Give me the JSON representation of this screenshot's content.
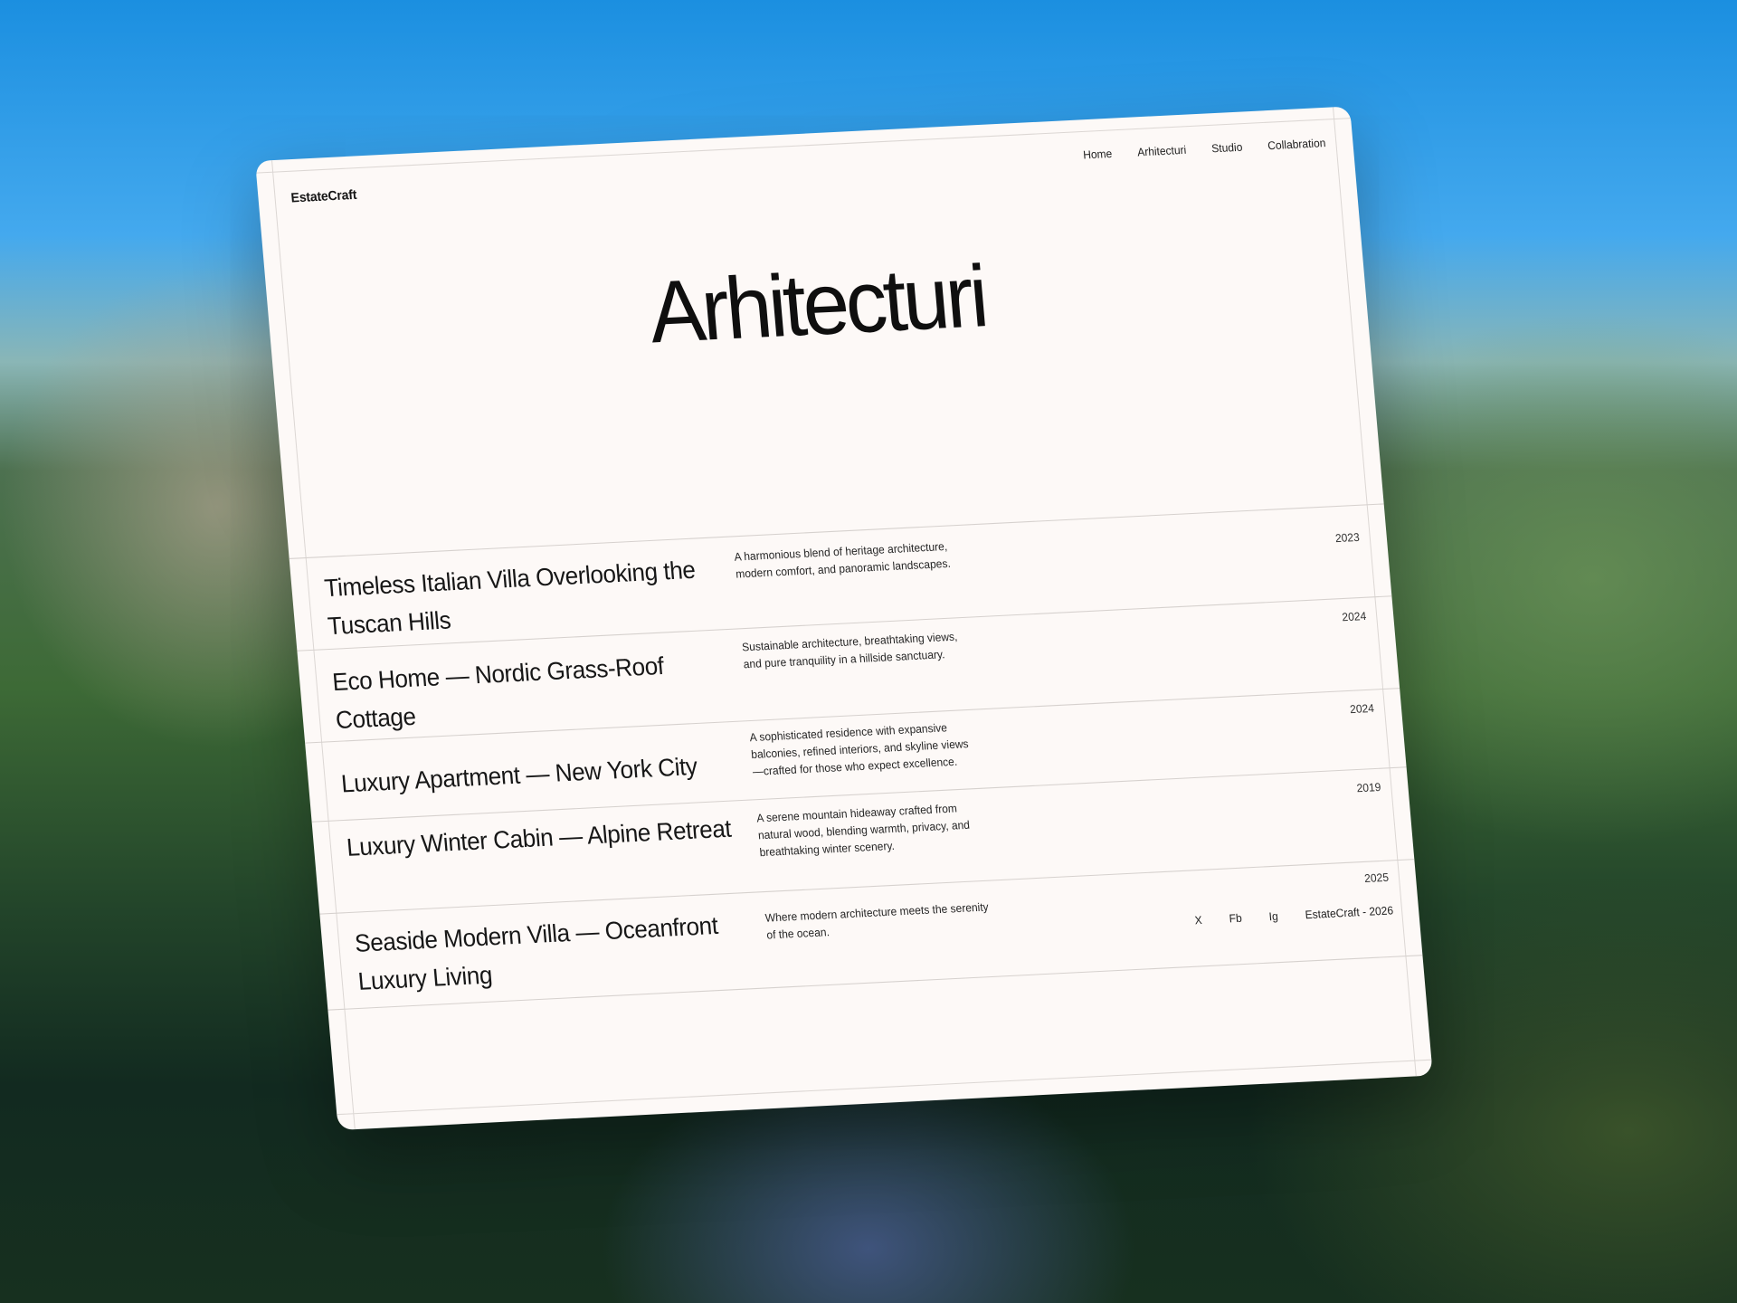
{
  "header": {
    "brand": "EstateCraft",
    "nav": [
      "Home",
      "Arhitecturi",
      "Studio",
      "Collabration"
    ]
  },
  "page": {
    "title": "Arhitecturi"
  },
  "projects": [
    {
      "name": "Timeless Italian Villa Overlooking the Tuscan Hills",
      "description": "A harmonious blend of heritage architecture, modern comfort, and panoramic landscapes.",
      "year": "2023"
    },
    {
      "name": "Eco Home — Nordic Grass-Roof Cottage",
      "description": "Sustainable architecture, breathtaking views, and pure tranquility in a hillside sanctuary.",
      "year": "2024"
    },
    {
      "name": "Luxury Apartment — New York City",
      "description": "A sophisticated residence with expansive balconies, refined interiors, and skyline views —crafted for those who expect excellence.",
      "year": "2024"
    },
    {
      "name": "Luxury Winter Cabin — Alpine Retreat",
      "description": "A serene mountain hideaway crafted from natural wood, blending warmth, privacy, and breathtaking winter scenery.",
      "year": "2019"
    },
    {
      "name": "Seaside Modern Villa — Oceanfront Luxury Living",
      "description": "Where modern architecture meets the serenity of the ocean.",
      "year": "2025"
    }
  ],
  "footer": {
    "links": [
      "X",
      "Fb",
      "Ig"
    ],
    "copyright": "EstateCraft - 2026"
  }
}
